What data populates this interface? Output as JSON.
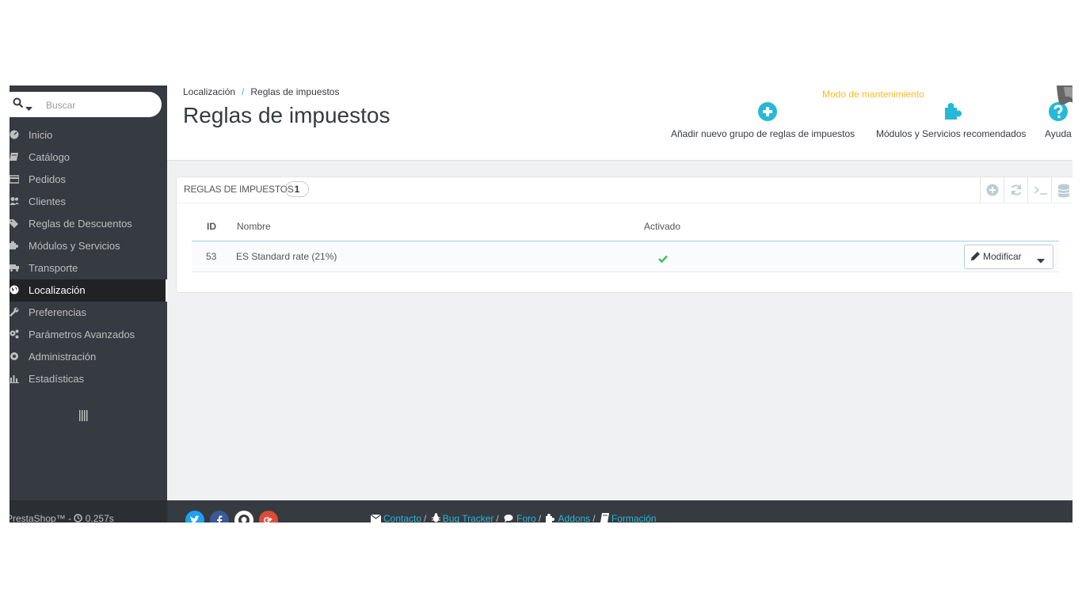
{
  "search": {
    "placeholder": "Buscar"
  },
  "sidebar": {
    "items": [
      {
        "label": "Inicio",
        "icon": "dashboard-icon"
      },
      {
        "label": "Catálogo",
        "icon": "book-icon"
      },
      {
        "label": "Pedidos",
        "icon": "credit-card-icon"
      },
      {
        "label": "Clientes",
        "icon": "users-icon"
      },
      {
        "label": "Reglas de Descuentos",
        "icon": "tags-icon"
      },
      {
        "label": "Módulos y Servicios",
        "icon": "puzzle-icon"
      },
      {
        "label": "Transporte",
        "icon": "truck-icon"
      },
      {
        "label": "Localización",
        "icon": "globe-icon",
        "active": true
      },
      {
        "label": "Preferencias",
        "icon": "wrench-icon"
      },
      {
        "label": "Parámetros Avanzados",
        "icon": "cogs-icon"
      },
      {
        "label": "Administración",
        "icon": "cog-icon"
      },
      {
        "label": "Estadísticas",
        "icon": "bar-chart-icon"
      }
    ]
  },
  "header": {
    "breadcrumb": {
      "parent": "Localización",
      "separator": "/",
      "current": "Reglas de impuestos"
    },
    "title": "Reglas de impuestos",
    "maintenance": "Modo de mantenimiento",
    "toolbar": {
      "add_label": "Añadir nuevo grupo de reglas de impuestos",
      "modules_label": "Módulos y Servicios recomendados",
      "help_label": "Ayuda"
    }
  },
  "panel": {
    "title": "Reglas de impuestos",
    "count": "1",
    "columns": {
      "id": "ID",
      "name": "Nombre",
      "enabled": "Activado"
    },
    "rows": [
      {
        "id": "53",
        "name": "ES Standard rate (21%)",
        "enabled": true,
        "action": "Modificar"
      }
    ]
  },
  "footer": {
    "version": "PrestaShop™ - ",
    "load_time": "0.257s",
    "links": {
      "contact": "Contacto",
      "bug": "Bug Tracker",
      "forum": "Foro",
      "addons": "Addons",
      "training": "Formación",
      "separator": "/"
    }
  },
  "colors": {
    "sidebar_bg": "#363a41",
    "accent": "#25b9d7",
    "maintenance": "#fbbb22",
    "success": "#3ec256"
  }
}
